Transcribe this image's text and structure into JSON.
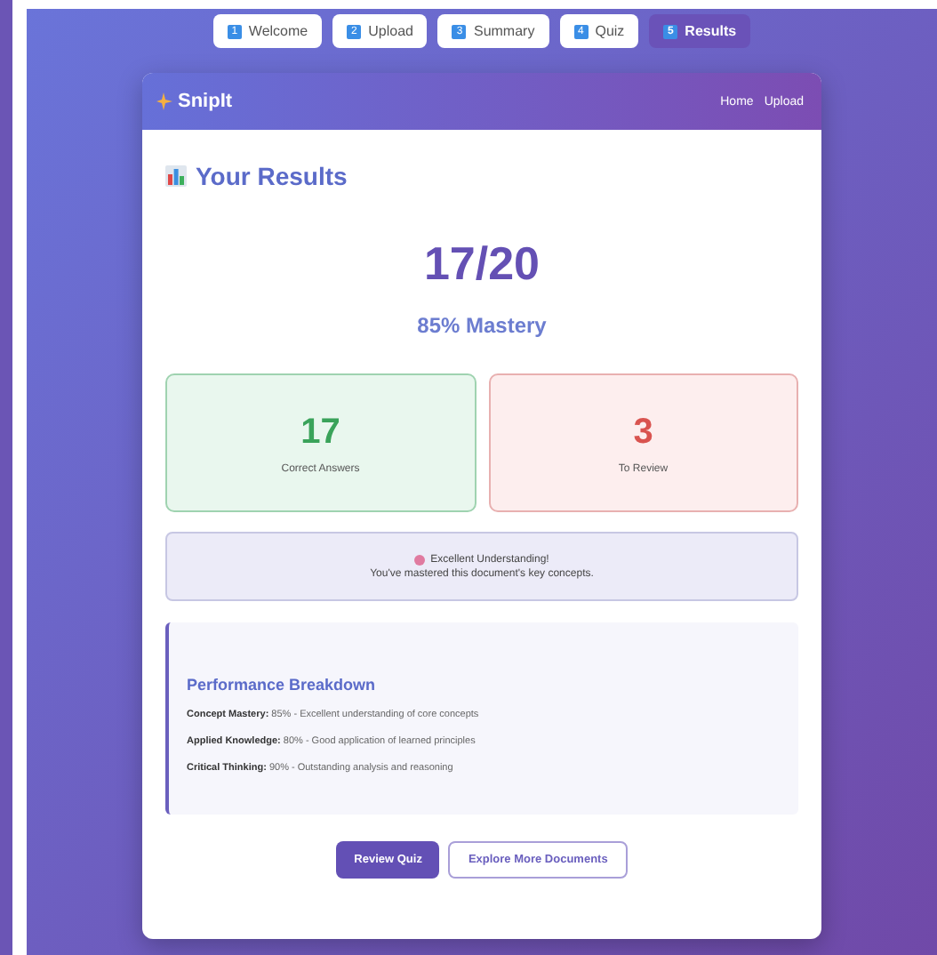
{
  "steps": [
    {
      "number": "1",
      "label": "Welcome",
      "selected": false
    },
    {
      "number": "2",
      "label": "Upload",
      "selected": false
    },
    {
      "number": "3",
      "label": "Summary",
      "selected": false
    },
    {
      "number": "4",
      "label": "Quiz",
      "selected": false
    },
    {
      "number": "5",
      "label": "Results",
      "selected": true
    }
  ],
  "app": {
    "brand": "SnipIt",
    "nav_links": [
      "Home",
      "Upload"
    ]
  },
  "results": {
    "title": "Your Results",
    "score": "17/20",
    "mastery": "85% Mastery",
    "stats": [
      {
        "kind": "correct",
        "value": "17",
        "label": "Correct Answers"
      },
      {
        "kind": "review",
        "value": "3",
        "label": "To Review"
      }
    ],
    "message": {
      "title": "Excellent Understanding!",
      "text": "You've mastered this document's key concepts."
    },
    "breakdown": {
      "title": "Performance Breakdown",
      "items": [
        "**Concept Mastery:** 85% - Excellent understanding of core concepts",
        "**Applied Knowledge:** 80% - Good application of learned principles",
        "**Critical Thinking:** 90% - Outstanding analysis and reasoning"
      ]
    },
    "buttons": [
      {
        "kind": "primary",
        "label": "Review Quiz"
      },
      {
        "kind": "secondary",
        "label": "Explore More Documents"
      }
    ]
  }
}
